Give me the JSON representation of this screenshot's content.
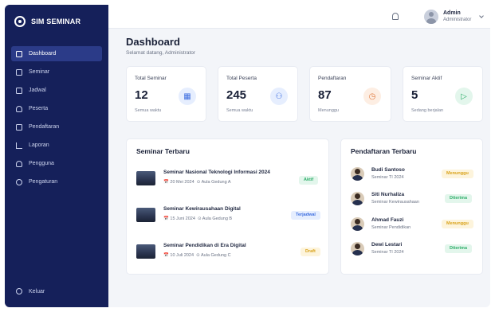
{
  "brand": {
    "name": "SIM SEMINAR"
  },
  "sidebar": {
    "items": [
      {
        "label": "Dashboard",
        "icon": "grid-icon"
      },
      {
        "label": "Seminar",
        "icon": "calendar-icon"
      },
      {
        "label": "Jadwal",
        "icon": "clock-icon"
      },
      {
        "label": "Peserta",
        "icon": "people-icon"
      },
      {
        "label": "Pendaftaran",
        "icon": "clipboard-icon"
      },
      {
        "label": "Laporan",
        "icon": "chart-icon"
      },
      {
        "label": "Pengguna",
        "icon": "user-icon"
      },
      {
        "label": "Pengaturan",
        "icon": "gear-icon"
      }
    ],
    "logout": "Keluar"
  },
  "topbar": {
    "user_name": "Admin",
    "user_role": "Administrator"
  },
  "page": {
    "title": "Dashboard",
    "subtitle": "Selamat datang, Administrator"
  },
  "stats": [
    {
      "label": "Total Seminar",
      "value": "12",
      "note": "Semua waktu",
      "icon": "▦",
      "icon_color": "#3f6fe0",
      "icon_bg": "#e6eefe"
    },
    {
      "label": "Total Peserta",
      "value": "245",
      "note": "Semua waktu",
      "icon": "⚇",
      "icon_color": "#3f6fe0",
      "icon_bg": "#e6eefe"
    },
    {
      "label": "Pendaftaran",
      "value": "87",
      "note": "Menunggu",
      "icon": "◷",
      "icon_color": "#e07a3f",
      "icon_bg": "#fdeee3"
    },
    {
      "label": "Seminar Aktif",
      "value": "5",
      "note": "Sedang berjalan",
      "icon": "▷",
      "icon_color": "#2fae6a",
      "icon_bg": "#e3f6ec"
    }
  ],
  "seminars": {
    "title": "Seminar Terbaru",
    "items": [
      {
        "title": "Seminar Nasional Teknologi Informasi 2024",
        "date": "20 Mei 2024",
        "place": "Aula Gedung A",
        "status": "Aktif",
        "status_color": "#2fae6a",
        "status_bg": "#e3f6ec"
      },
      {
        "title": "Seminar Kewirausahaan Digital",
        "date": "15 Juni 2024",
        "place": "Aula Gedung B",
        "status": "Terjadwal",
        "status_color": "#3f6fe0",
        "status_bg": "#e6eefe"
      },
      {
        "title": "Seminar Pendidikan di Era Digital",
        "date": "10 Juli 2024",
        "place": "Aula Gedung C",
        "status": "Draft",
        "status_color": "#d9a21a",
        "status_bg": "#fdf4dc"
      }
    ]
  },
  "registrations": {
    "title": "Pendaftaran Terbaru",
    "items": [
      {
        "name": "Budi Santoso",
        "seminar": "Seminar TI 2024",
        "status": "Menunggu",
        "status_color": "#d9a21a",
        "status_bg": "#fdf4dc"
      },
      {
        "name": "Siti Nurhaliza",
        "seminar": "Seminar Kewirausahaan",
        "status": "Diterima",
        "status_color": "#2fae6a",
        "status_bg": "#e3f6ec"
      },
      {
        "name": "Ahmad Fauzi",
        "seminar": "Seminar Pendidikan",
        "status": "Menunggu",
        "status_color": "#d9a21a",
        "status_bg": "#fdf4dc"
      },
      {
        "name": "Dewi Lestari",
        "seminar": "Seminar TI 2024",
        "status": "Diterima",
        "status_color": "#2fae6a",
        "status_bg": "#e3f6ec"
      }
    ]
  }
}
